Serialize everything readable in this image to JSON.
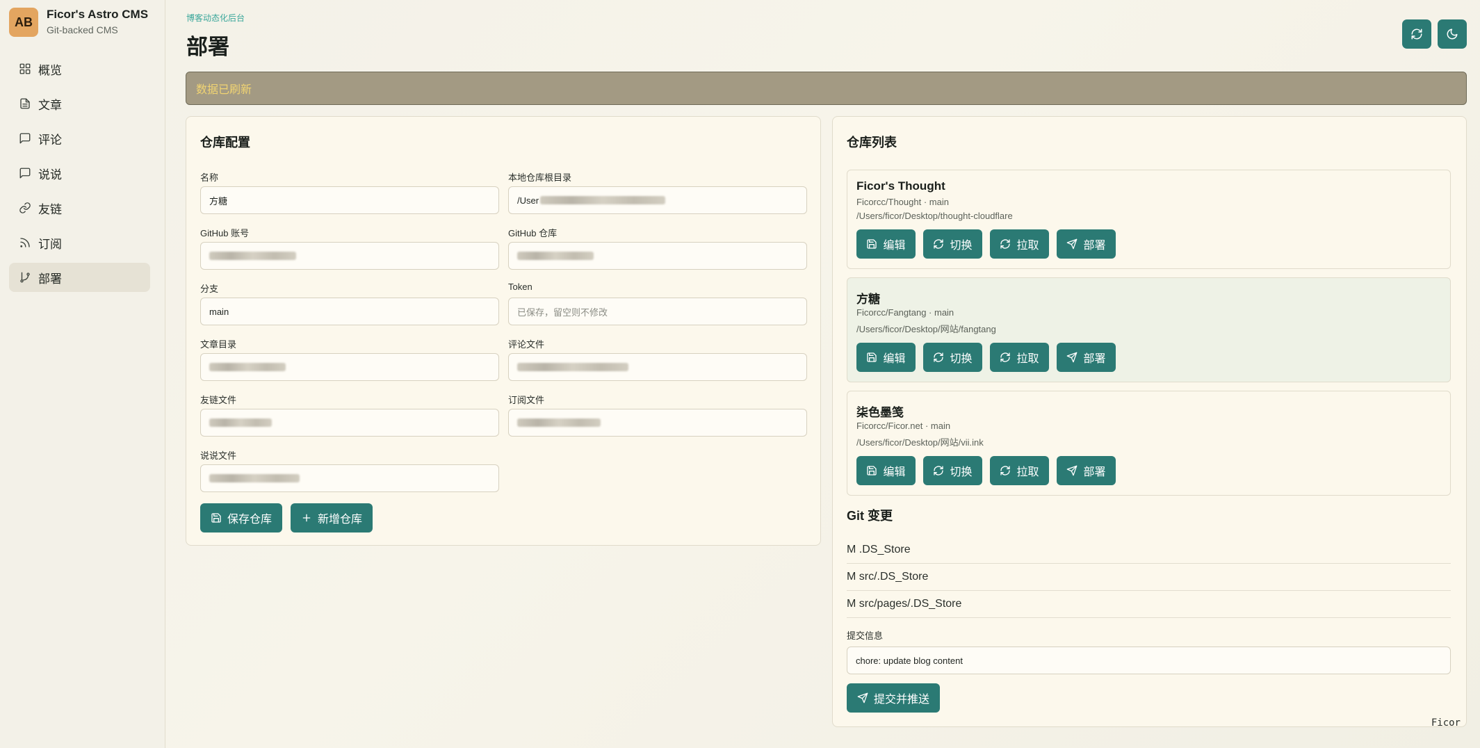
{
  "brand": {
    "logo": "AB",
    "title": "Ficor's Astro CMS",
    "subtitle": "Git-backed CMS"
  },
  "nav": [
    {
      "label": "概览",
      "icon": "grid-icon"
    },
    {
      "label": "文章",
      "icon": "file-icon"
    },
    {
      "label": "评论",
      "icon": "message-icon"
    },
    {
      "label": "说说",
      "icon": "message-icon"
    },
    {
      "label": "友链",
      "icon": "link-icon"
    },
    {
      "label": "订阅",
      "icon": "rss-icon"
    },
    {
      "label": "部署",
      "icon": "git-branch-icon",
      "active": true
    }
  ],
  "header": {
    "breadcrumb": "博客动态化后台",
    "title": "部署"
  },
  "top_buttons": [
    {
      "icon": "refresh-icon"
    },
    {
      "icon": "moon-icon"
    }
  ],
  "alert": {
    "text": "数据已刷新"
  },
  "repo_config": {
    "title": "仓库配置",
    "fields": {
      "name": {
        "label": "名称",
        "value": "方糖"
      },
      "root": {
        "label": "本地仓库根目录",
        "value": "/User"
      },
      "gh_account": {
        "label": "GitHub 账号",
        "value": ""
      },
      "gh_repo": {
        "label": "GitHub 仓库",
        "value": ""
      },
      "branch": {
        "label": "分支",
        "value": "main"
      },
      "token": {
        "label": "Token",
        "placeholder": "已保存，留空则不修改"
      },
      "post_dir": {
        "label": "文章目录",
        "value": ""
      },
      "comment_file": {
        "label": "评论文件",
        "value": ""
      },
      "friend_file": {
        "label": "友链文件",
        "value": ""
      },
      "rss_file": {
        "label": "订阅文件",
        "value": ""
      },
      "talk_file": {
        "label": "说说文件",
        "value": ""
      }
    },
    "save_label": "保存仓库",
    "add_label": "新增仓库"
  },
  "repo_list": {
    "title": "仓库列表",
    "actions": {
      "edit": "编辑",
      "switch": "切换",
      "pull": "拉取",
      "deploy": "部署"
    },
    "repos": [
      {
        "name": "Ficor's Thought",
        "remote": "Ficorcc/Thought · main",
        "path": "/Users/ficor/Desktop/thought-cloudflare"
      },
      {
        "name": "方糖",
        "remote": "Ficorcc/Fangtang · main",
        "path": "/Users/ficor/Desktop/网站/fangtang"
      },
      {
        "name": "柒色墨笺",
        "remote": "Ficorcc/Ficor.net · main",
        "path": "/Users/ficor/Desktop/网站/vii.ink"
      }
    ]
  },
  "git": {
    "title": "Git 变更",
    "changes": [
      "M .DS_Store",
      "M src/.DS_Store",
      "M src/pages/.DS_Store"
    ],
    "commit_label": "提交信息",
    "commit_value": "chore: update blog content",
    "submit_label": "提交并推送"
  },
  "watermark": "Ficor"
}
